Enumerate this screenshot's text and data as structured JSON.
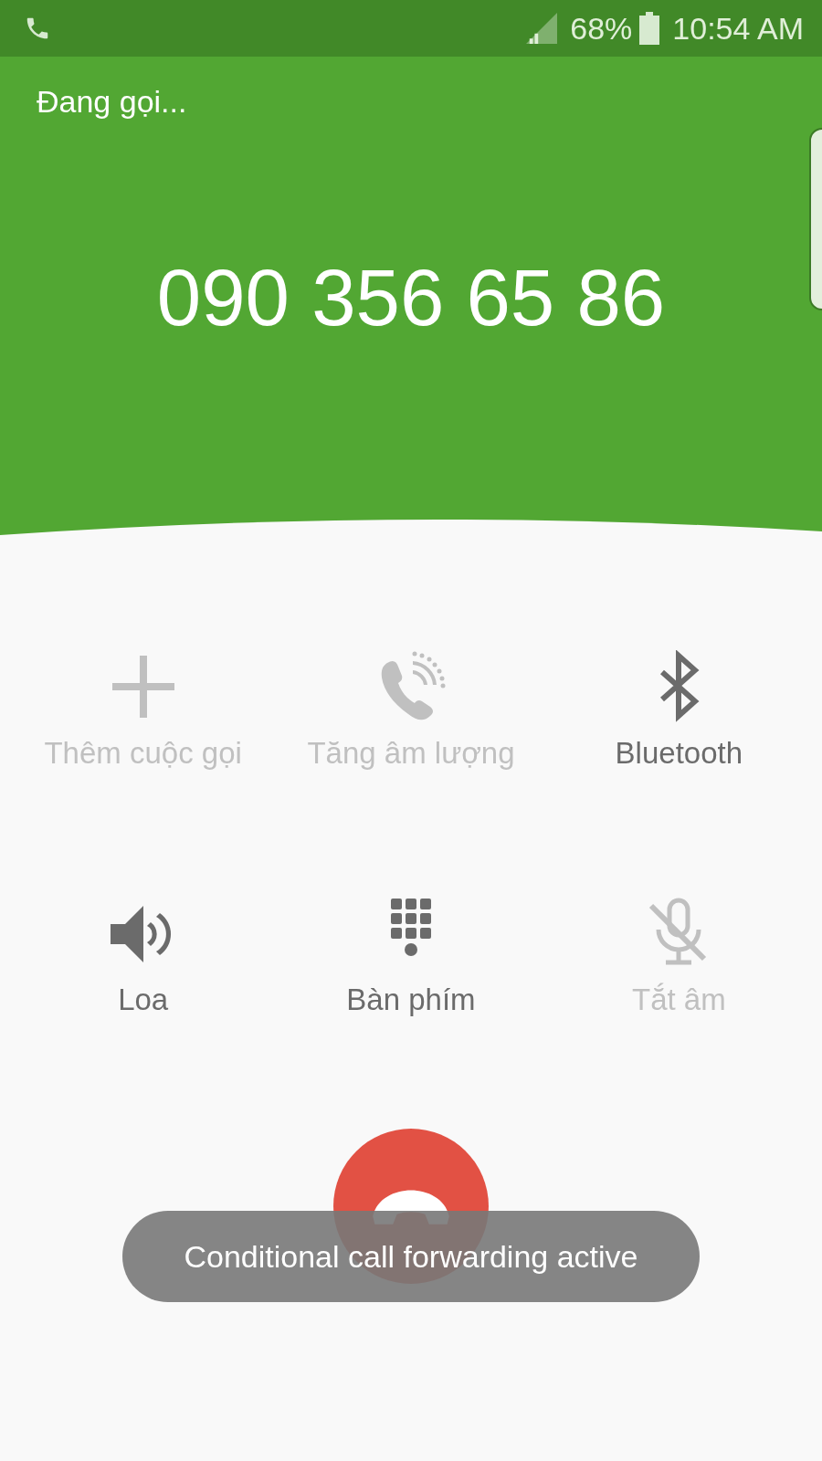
{
  "status_bar": {
    "battery": "68%",
    "time": "10:54 AM"
  },
  "call": {
    "status": "Đang gọi...",
    "number": "090 356 65 86"
  },
  "actions": [
    {
      "kind": "add",
      "label": "Thêm cuộc gọi",
      "disabled": true
    },
    {
      "kind": "volume",
      "label": "Tăng âm lượng",
      "disabled": true
    },
    {
      "kind": "bluetooth",
      "label": "Bluetooth",
      "disabled": false
    },
    {
      "kind": "speaker",
      "label": "Loa",
      "disabled": false
    },
    {
      "kind": "keypad",
      "label": "Bàn phím",
      "disabled": false
    },
    {
      "kind": "mute",
      "label": "Tắt âm",
      "disabled": true
    }
  ],
  "toast": "Conditional call forwarding active"
}
